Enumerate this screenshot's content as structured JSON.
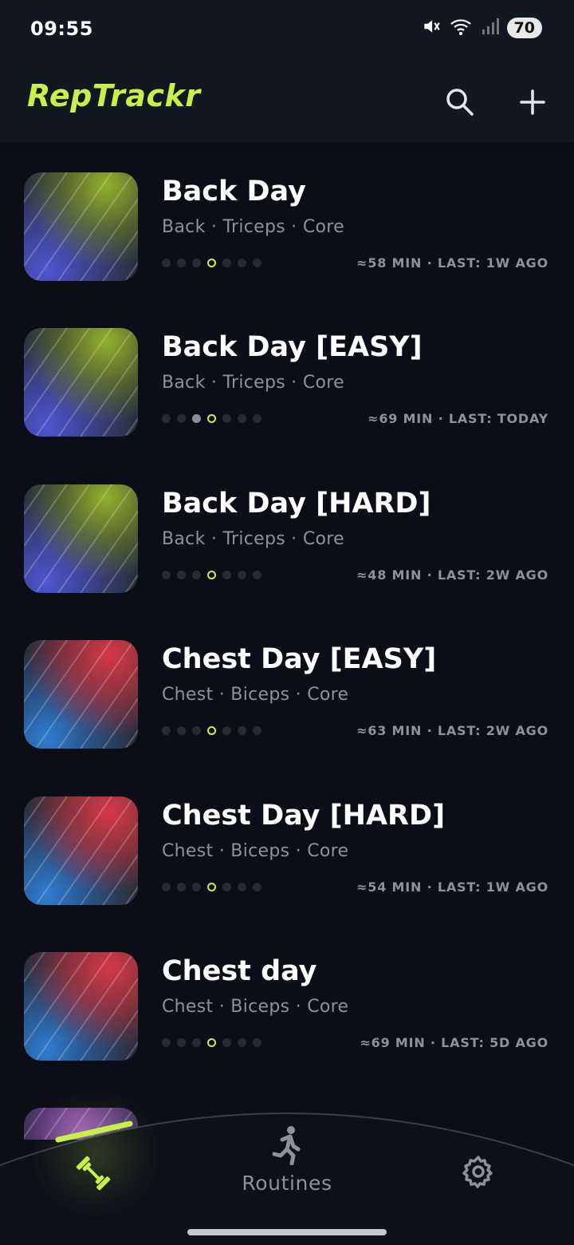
{
  "status_bar": {
    "time": "09:55",
    "battery": "70"
  },
  "app_bar": {
    "title": "RepTrackr"
  },
  "colors": {
    "accent": "#c8ef4a",
    "background": "#0b0e17",
    "bar": "#131722",
    "muted": "#8d919c"
  },
  "routines": [
    {
      "name": "Back Day",
      "muscles": "Back · Triceps · Core",
      "meta": "≈58 MIN · LAST: 1W AGO",
      "theme": "back",
      "progress_dots": [
        "empty",
        "empty",
        "empty",
        "current",
        "empty",
        "empty",
        "empty"
      ]
    },
    {
      "name": "Back Day [EASY]",
      "muscles": "Back · Triceps · Core",
      "meta": "≈69 MIN · LAST: TODAY",
      "theme": "back",
      "progress_dots": [
        "empty",
        "empty",
        "done",
        "current",
        "empty",
        "empty",
        "empty"
      ]
    },
    {
      "name": "Back Day [HARD]",
      "muscles": "Back · Triceps · Core",
      "meta": "≈48 MIN · LAST: 2W AGO",
      "theme": "back",
      "progress_dots": [
        "empty",
        "empty",
        "empty",
        "current",
        "empty",
        "empty",
        "empty"
      ]
    },
    {
      "name": "Chest Day [EASY]",
      "muscles": "Chest · Biceps · Core",
      "meta": "≈63 MIN · LAST: 2W AGO",
      "theme": "chest",
      "progress_dots": [
        "empty",
        "empty",
        "empty",
        "current",
        "empty",
        "empty",
        "empty"
      ]
    },
    {
      "name": "Chest Day [HARD]",
      "muscles": "Chest · Biceps · Core",
      "meta": "≈54 MIN · LAST: 1W AGO",
      "theme": "chest",
      "progress_dots": [
        "empty",
        "empty",
        "empty",
        "current",
        "empty",
        "empty",
        "empty"
      ]
    },
    {
      "name": "Chest day",
      "muscles": "Chest · Biceps · Core",
      "meta": "≈69 MIN · LAST: 5D AGO",
      "theme": "chest",
      "progress_dots": [
        "empty",
        "empty",
        "empty",
        "current",
        "empty",
        "empty",
        "empty"
      ]
    },
    {
      "name": "",
      "muscles": "",
      "meta": "",
      "theme": "purple",
      "progress_dots": []
    }
  ],
  "bottom_nav": {
    "items": [
      {
        "label": "",
        "icon": "dumbbell-icon",
        "active": true
      },
      {
        "label": "Routines",
        "icon": "running-person-icon",
        "active": false
      },
      {
        "label": "",
        "icon": "gear-icon",
        "active": false
      }
    ]
  }
}
